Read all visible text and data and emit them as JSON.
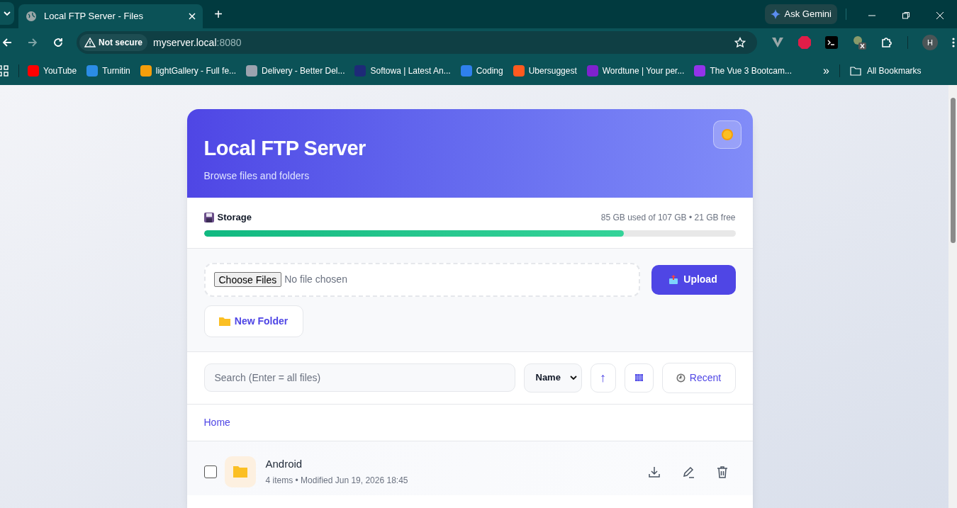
{
  "browser": {
    "tab": {
      "title": "Local FTP Server - Files",
      "selected": true
    },
    "new_tab": "+",
    "ask_gemini": "Ask Gemini",
    "security": "Not secure",
    "url_host": "myserver.local",
    "url_port": ":8080",
    "profile": "H",
    "bookmarks": [
      {
        "label": "YouTube",
        "color": "#ff0000"
      },
      {
        "label": "Turnitin",
        "color": "#2b8ce6"
      },
      {
        "label": "lightGallery - Full fe...",
        "color": "#f59e0b"
      },
      {
        "label": "Delivery - Better Del...",
        "color": "#9ca3af"
      },
      {
        "label": "Softowa | Latest An...",
        "color": "#1e2a78"
      },
      {
        "label": "Coding",
        "color": "#2f80ed"
      },
      {
        "label": "Ubersuggest",
        "color": "#ff5a1f"
      },
      {
        "label": "Wordtune | Your per...",
        "color": "#7e22ce"
      },
      {
        "label": "The Vue 3 Bootcam...",
        "color": "#9333ea"
      }
    ],
    "more": "»",
    "all_bookmarks": "All Bookmarks"
  },
  "header": {
    "title": "Local FTP Server",
    "subtitle": "Browse files and folders"
  },
  "storage": {
    "label": "Storage",
    "summary": "85 GB used of 107 GB • 21 GB free",
    "level": 0.79
  },
  "upload": {
    "choose_button": "Choose Files",
    "file_status": "No file chosen",
    "upload_button": "Upload",
    "new_folder_button": "New Folder"
  },
  "toolbar": {
    "search_placeholder": "Search (Enter = all files)",
    "sort": "Name",
    "direction": "↑",
    "recent": "Recent"
  },
  "breadcrumb": [
    "Home"
  ],
  "files": [
    {
      "name": "Android",
      "meta": "4 items • Modified Jun 19, 2026 18:45",
      "checked": false,
      "kind": "folder"
    }
  ]
}
